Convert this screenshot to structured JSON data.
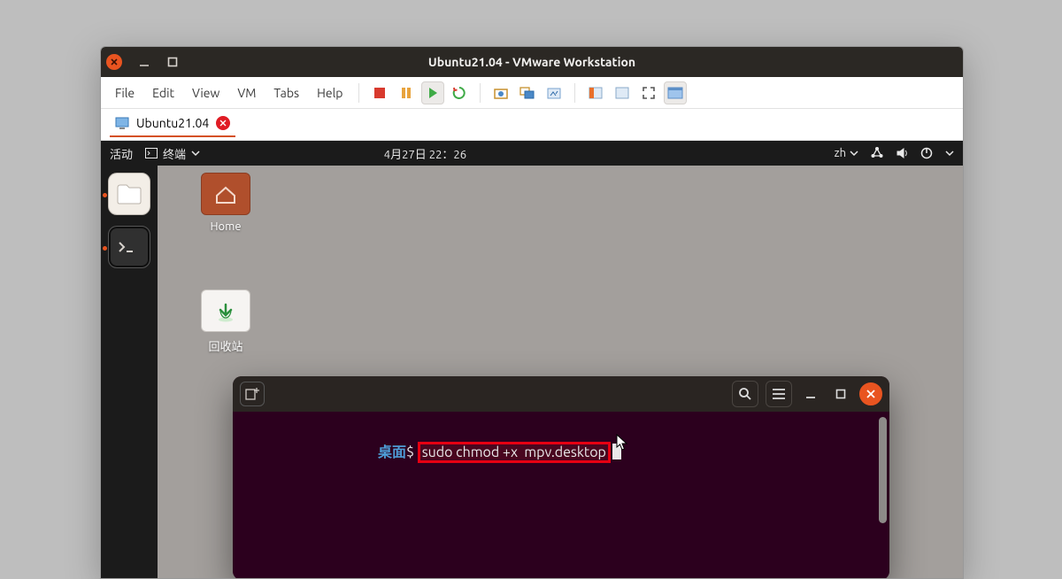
{
  "vmware": {
    "title": "Ubuntu21.04 - VMware Workstation",
    "menubar": [
      "File",
      "Edit",
      "View",
      "VM",
      "Tabs",
      "Help"
    ],
    "tab": {
      "label": "Ubuntu21.04"
    },
    "toolbar_icons": [
      "stop",
      "pause",
      "play",
      "restart",
      "snapshot",
      "snapshot-mgr",
      "screenshot",
      "unity",
      "fullscreen",
      "stretch",
      "console"
    ]
  },
  "ubuntu": {
    "topbar": {
      "activities": "活动",
      "app_label": "终端",
      "clock": "4月27日  22：26",
      "input_method": "zh"
    },
    "desktop_icons": {
      "home": "Home",
      "trash": "回收站"
    }
  },
  "terminal": {
    "prompt_dir": "桌面",
    "prompt_sep": "$ ",
    "command": "sudo chmod +x  mpv.desktop"
  }
}
